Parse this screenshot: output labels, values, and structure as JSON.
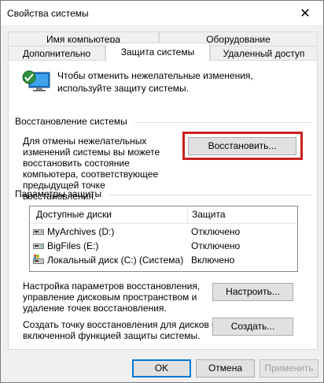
{
  "window": {
    "title": "Свойства системы",
    "close_glyph": "✕"
  },
  "tabs": {
    "computer_name": "Имя компьютера",
    "hardware": "Оборудование",
    "advanced": "Дополнительно",
    "protection": "Защита системы",
    "remote": "Удаленный доступ",
    "active": "Защита системы"
  },
  "intro": {
    "text": "Чтобы отменить нежелательные изменения, используйте защиту системы."
  },
  "restore": {
    "group_label": "Восстановление системы",
    "description": "Для отмены нежелательных изменений системы вы можете восстановить состояние компьютера, соответствующее предыдущей точке восстановления.",
    "button": "Восстановить..."
  },
  "protection": {
    "group_label": "Параметры защиты",
    "col_disks": "Доступные диски",
    "col_protection": "Защита",
    "drives": [
      {
        "name": "MyArchives (D:)",
        "status": "Отключено",
        "icon": "drive-icon"
      },
      {
        "name": "BigFiles (E:)",
        "status": "Отключено",
        "icon": "drive-icon"
      },
      {
        "name": "Локальный диск (C:) (Система)",
        "status": "Включено",
        "icon": "system-drive-icon"
      }
    ]
  },
  "configure": {
    "text": "Настройка параметров восстановления, управление дисковым пространством и удаление точек восстановления.",
    "button": "Настроить..."
  },
  "create": {
    "text": "Создать точку восстановления для дисков с включенной функцией защиты системы.",
    "button": "Создать..."
  },
  "footer": {
    "ok": "OK",
    "cancel": "Отмена",
    "apply": "Применить"
  },
  "colors": {
    "highlight": "#cc1e1e",
    "accent": "#0078d7"
  }
}
